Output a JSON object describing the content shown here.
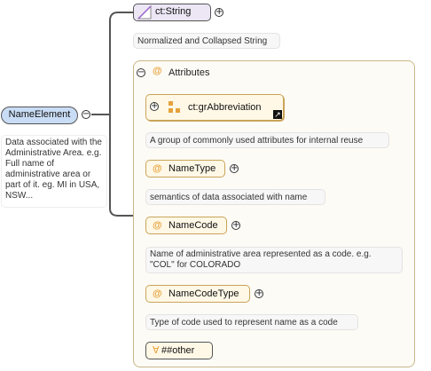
{
  "root": {
    "name": "NameElement",
    "doc": "Data associated with the Administrative Area. e.g. Full name of administrative area or part of it. eg. MI in USA, NSW..."
  },
  "type_node": {
    "name": "ct:String",
    "doc": "Normalized and Collapsed String"
  },
  "attributes_group": {
    "title": "Attributes",
    "items": [
      {
        "kind": "group",
        "name": "ct:grAbbreviation",
        "doc": "A group of commonly used attributes for internal reuse"
      },
      {
        "kind": "attribute",
        "name": "NameType",
        "doc": "semantics of data associated with name"
      },
      {
        "kind": "attribute",
        "name": "NameCode",
        "doc": "Name of administrative area represented as a code. e.g. \"COL\" for COLORADO"
      },
      {
        "kind": "attribute",
        "name": "NameCodeType",
        "doc": "Type of code used to represent name as a code"
      },
      {
        "kind": "any_attribute",
        "name": "##other"
      }
    ]
  },
  "colors": {
    "root_fill": "#c9dcf5",
    "type_fill": "#ece6f5",
    "attr_accent": "#e6a23c",
    "connector": "#555555"
  }
}
